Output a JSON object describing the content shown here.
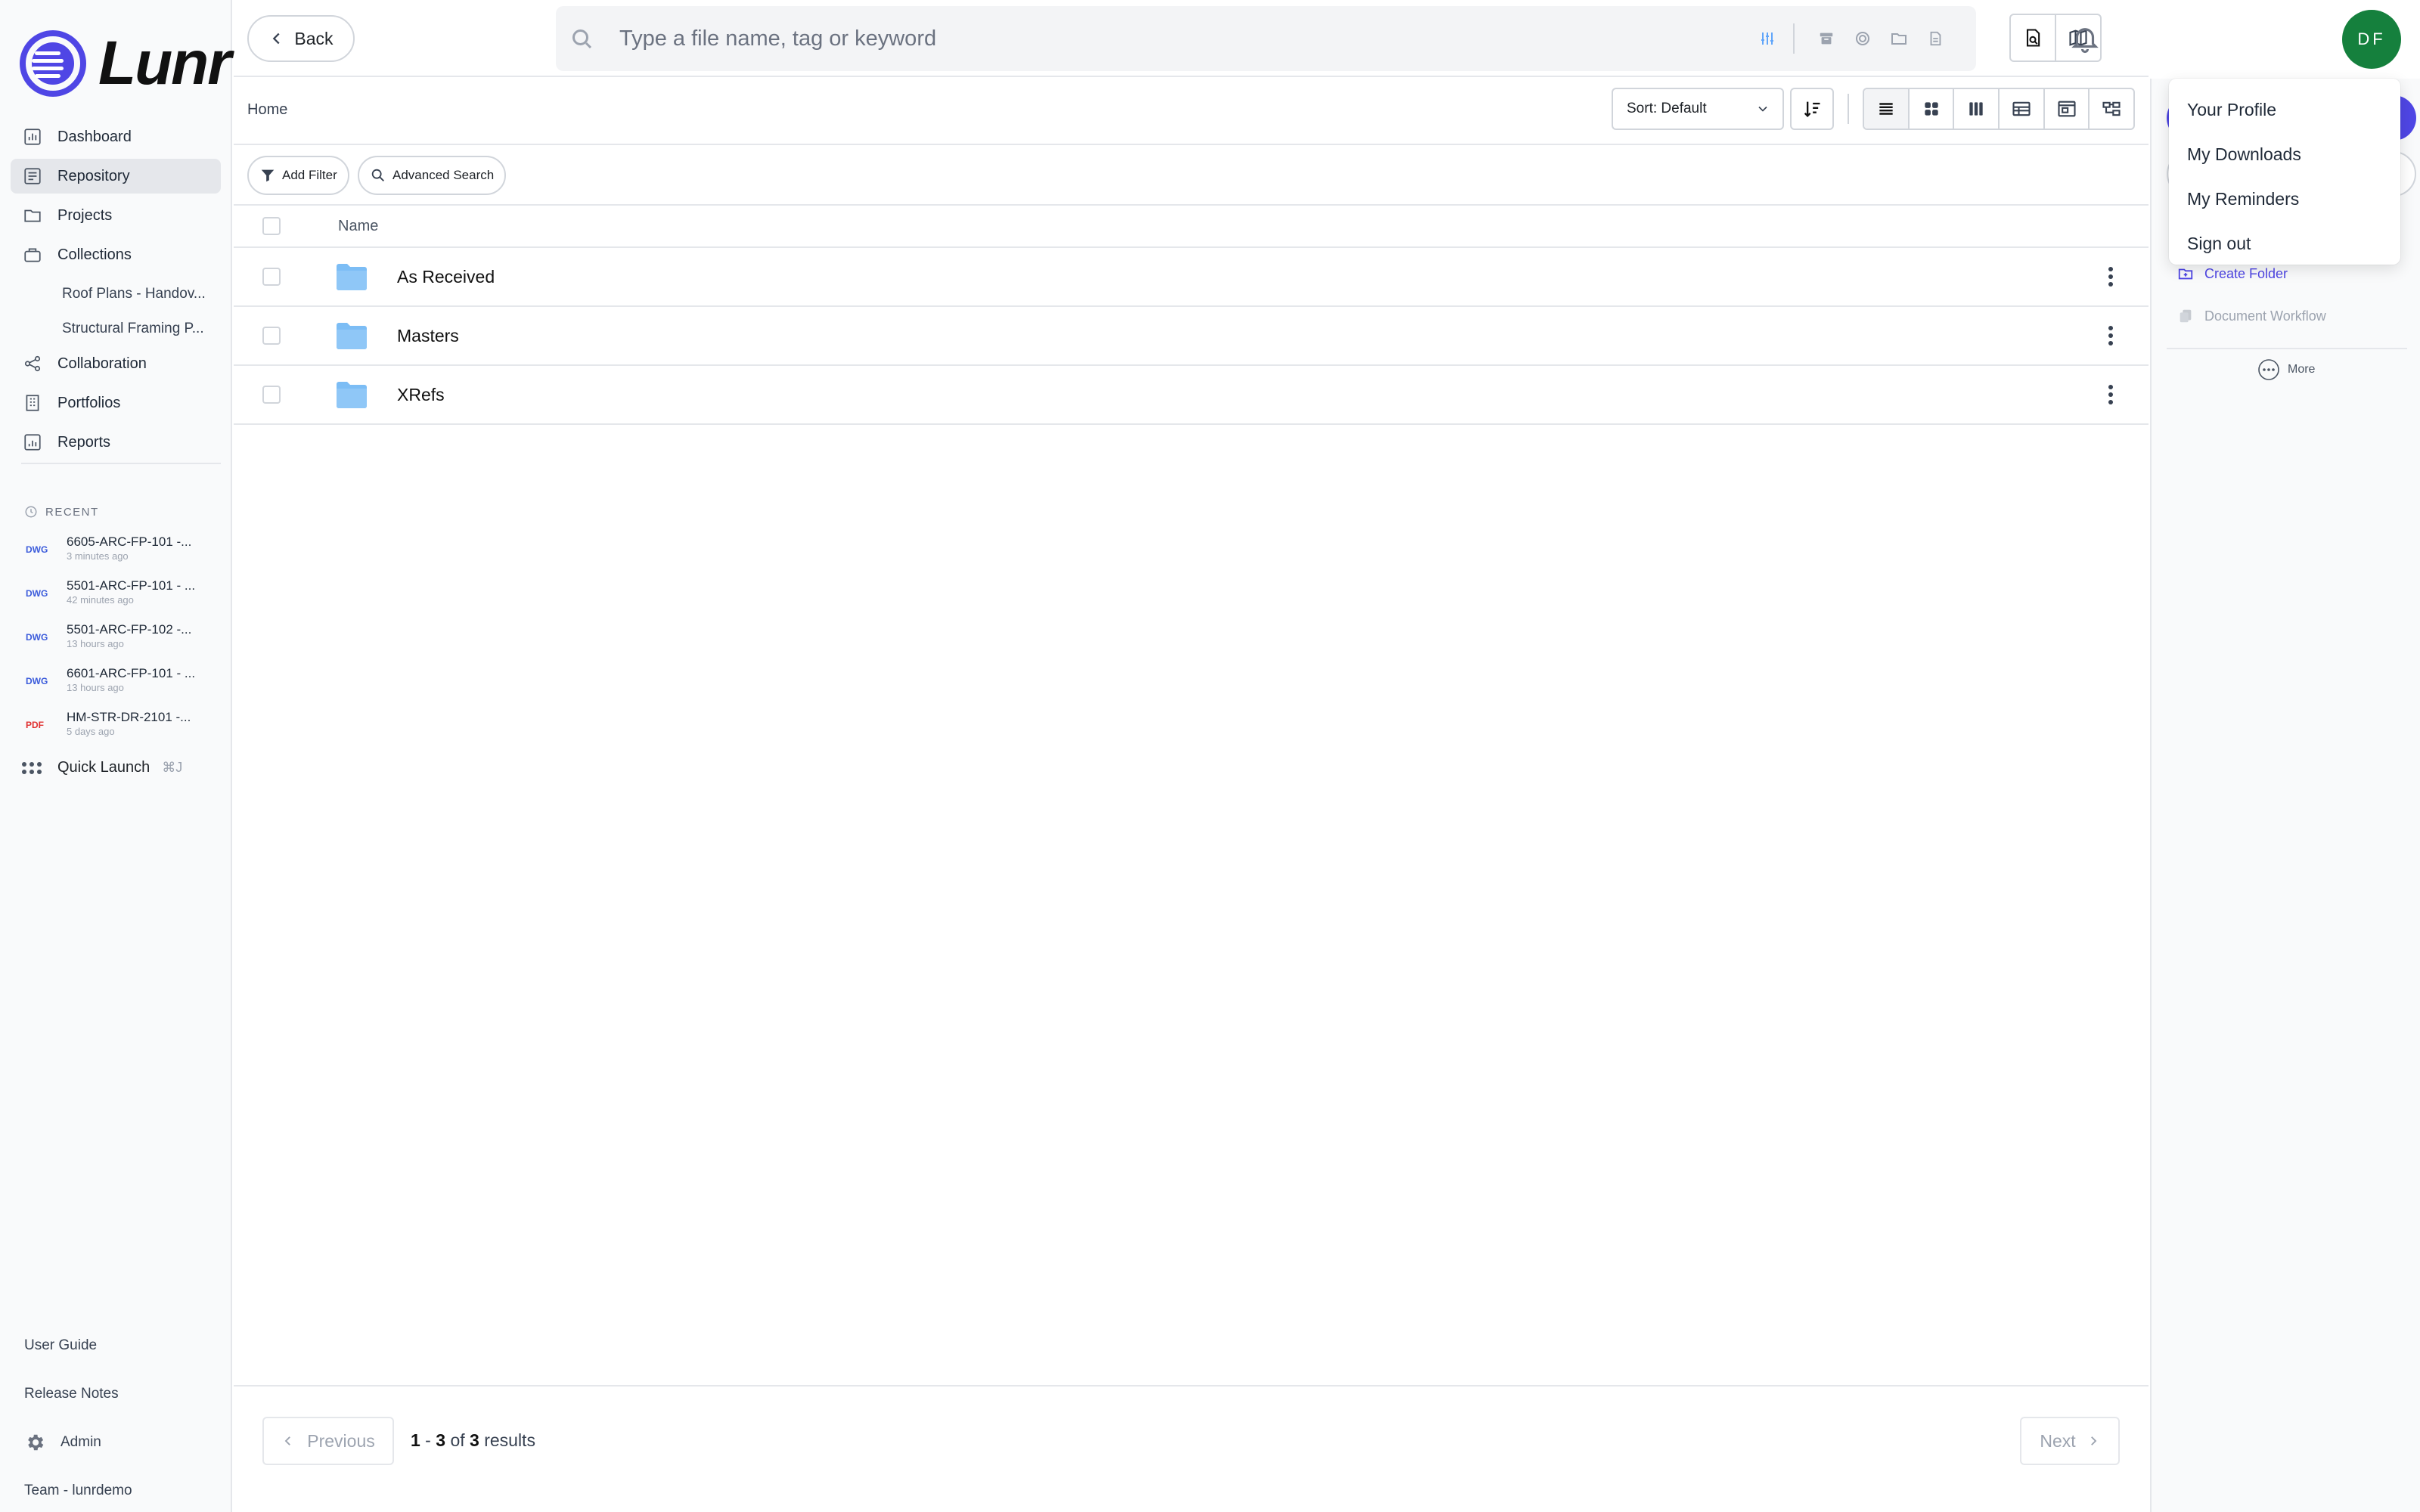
{
  "app": {
    "name": "Lunr"
  },
  "sidebar": {
    "items": [
      {
        "label": "Dashboard"
      },
      {
        "label": "Repository"
      },
      {
        "label": "Projects"
      },
      {
        "label": "Collections"
      },
      {
        "label": "Collaboration"
      },
      {
        "label": "Portfolios"
      },
      {
        "label": "Reports"
      }
    ],
    "collections": [
      {
        "label": "Roof Plans - Handov..."
      },
      {
        "label": "Structural Framing P..."
      }
    ],
    "recent_title": "RECENT",
    "recent": [
      {
        "type": "DWG",
        "name": "6605-ARC-FP-101 -...",
        "time": "3 minutes ago"
      },
      {
        "type": "DWG",
        "name": "5501-ARC-FP-101 - ...",
        "time": "42 minutes ago"
      },
      {
        "type": "DWG",
        "name": "5501-ARC-FP-102 -...",
        "time": "13 hours ago"
      },
      {
        "type": "DWG",
        "name": "6601-ARC-FP-101 - ...",
        "time": "13 hours ago"
      },
      {
        "type": "PDF",
        "name": "HM-STR-DR-2101 -...",
        "time": "5 days ago"
      }
    ],
    "quick_launch": {
      "label": "Quick Launch",
      "shortcut": "⌘J"
    },
    "bottom": {
      "user_guide": "User Guide",
      "release_notes": "Release Notes",
      "admin": "Admin",
      "team": "Team - lunrdemo"
    }
  },
  "topbar": {
    "back_label": "Back",
    "search_placeholder": "Type a file name, tag or keyword",
    "avatar_initials": "DF"
  },
  "toolbar": {
    "breadcrumb": "Home",
    "sort_label": "Sort: Default"
  },
  "filters": {
    "add_filter": "Add Filter",
    "advanced_search": "Advanced Search"
  },
  "table": {
    "column_name": "Name",
    "rows": [
      {
        "name": "As Received"
      },
      {
        "name": "Masters"
      },
      {
        "name": "XRefs"
      }
    ]
  },
  "pagination": {
    "previous": "Previous",
    "next": "Next",
    "from": "1",
    "to": "3",
    "of_word": "of",
    "total": "3",
    "results_word": "results"
  },
  "right_panel": {
    "create_folder": "Create Folder",
    "document_workflow": "Document Workflow",
    "more": "More"
  },
  "profile_menu": {
    "items": [
      "Your Profile",
      "My Downloads",
      "My Reminders",
      "Sign out"
    ]
  },
  "colors": {
    "accent": "#4f46e5",
    "avatar": "#15803d",
    "folder": "#7cbdf5"
  }
}
